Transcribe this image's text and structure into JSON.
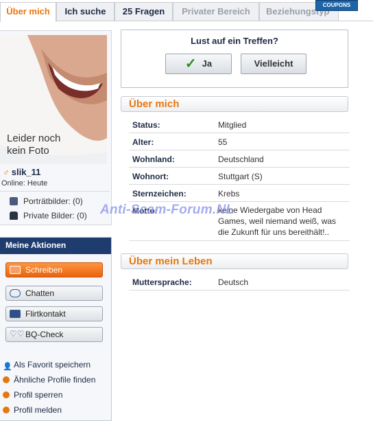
{
  "tabs": [
    {
      "label": "Über mich",
      "state": "active"
    },
    {
      "label": "Ich suche",
      "state": "normal"
    },
    {
      "label": "25 Fragen",
      "state": "normal"
    },
    {
      "label": "Privater Bereich",
      "state": "muted"
    },
    {
      "label": "Beziehungstyp",
      "state": "muted"
    }
  ],
  "coupons_label": "COUPONS",
  "profile": {
    "no_photo_line1": "Leider noch",
    "no_photo_line2": "kein Foto",
    "gender_icon": "male-symbol",
    "username": "slik_11",
    "online_status": "Online: Heute",
    "portrait_pics": "Porträtbilder: (0)",
    "private_pics": "Private Bilder: (0)"
  },
  "actions": {
    "title": "Meine Aktionen",
    "buttons": [
      {
        "label": "Schreiben",
        "icon": "envelope-icon"
      },
      {
        "label": "Chatten",
        "icon": "chat-bubble-icon"
      },
      {
        "label": "Flirtkontakt",
        "icon": "flirt-card-icon"
      },
      {
        "label": "BQ-Check",
        "icon": "hearts-icon"
      }
    ],
    "links": [
      {
        "label": "Als Favorit speichern",
        "icon": "add-favorite-icon"
      },
      {
        "label": "Ähnliche Profile finden",
        "icon": "arrow-bullet-icon"
      },
      {
        "label": "Profil sperren",
        "icon": "arrow-bullet-icon"
      },
      {
        "label": "Profil melden",
        "icon": "arrow-bullet-icon"
      }
    ]
  },
  "meeting": {
    "question": "Lust auf ein Treffen?",
    "yes_label": "Ja",
    "maybe_label": "Vielleicht"
  },
  "about": {
    "title": "Über mich",
    "rows": [
      {
        "key": "Status:",
        "value": "Mitglied"
      },
      {
        "key": "Alter:",
        "value": "55"
      },
      {
        "key": "Wohnland:",
        "value": "Deutschland"
      },
      {
        "key": "Wohnort:",
        "value": "Stuttgart (S)"
      },
      {
        "key": "Sternzeichen:",
        "value": "Krebs"
      },
      {
        "key": "Motto:",
        "value": "keine Wiedergabe von Head Games, weil niemand weiß, was die Zukunft für uns bereithält!.."
      }
    ]
  },
  "life": {
    "title": "Über mein Leben",
    "rows": [
      {
        "key": "Muttersprache:",
        "value": "Deutsch"
      }
    ]
  },
  "watermark": "Anti-Scam-Forum.NL",
  "colors": {
    "accent": "#e8760e",
    "navy": "#1e3c6e",
    "text_dark": "#1d2a44"
  }
}
